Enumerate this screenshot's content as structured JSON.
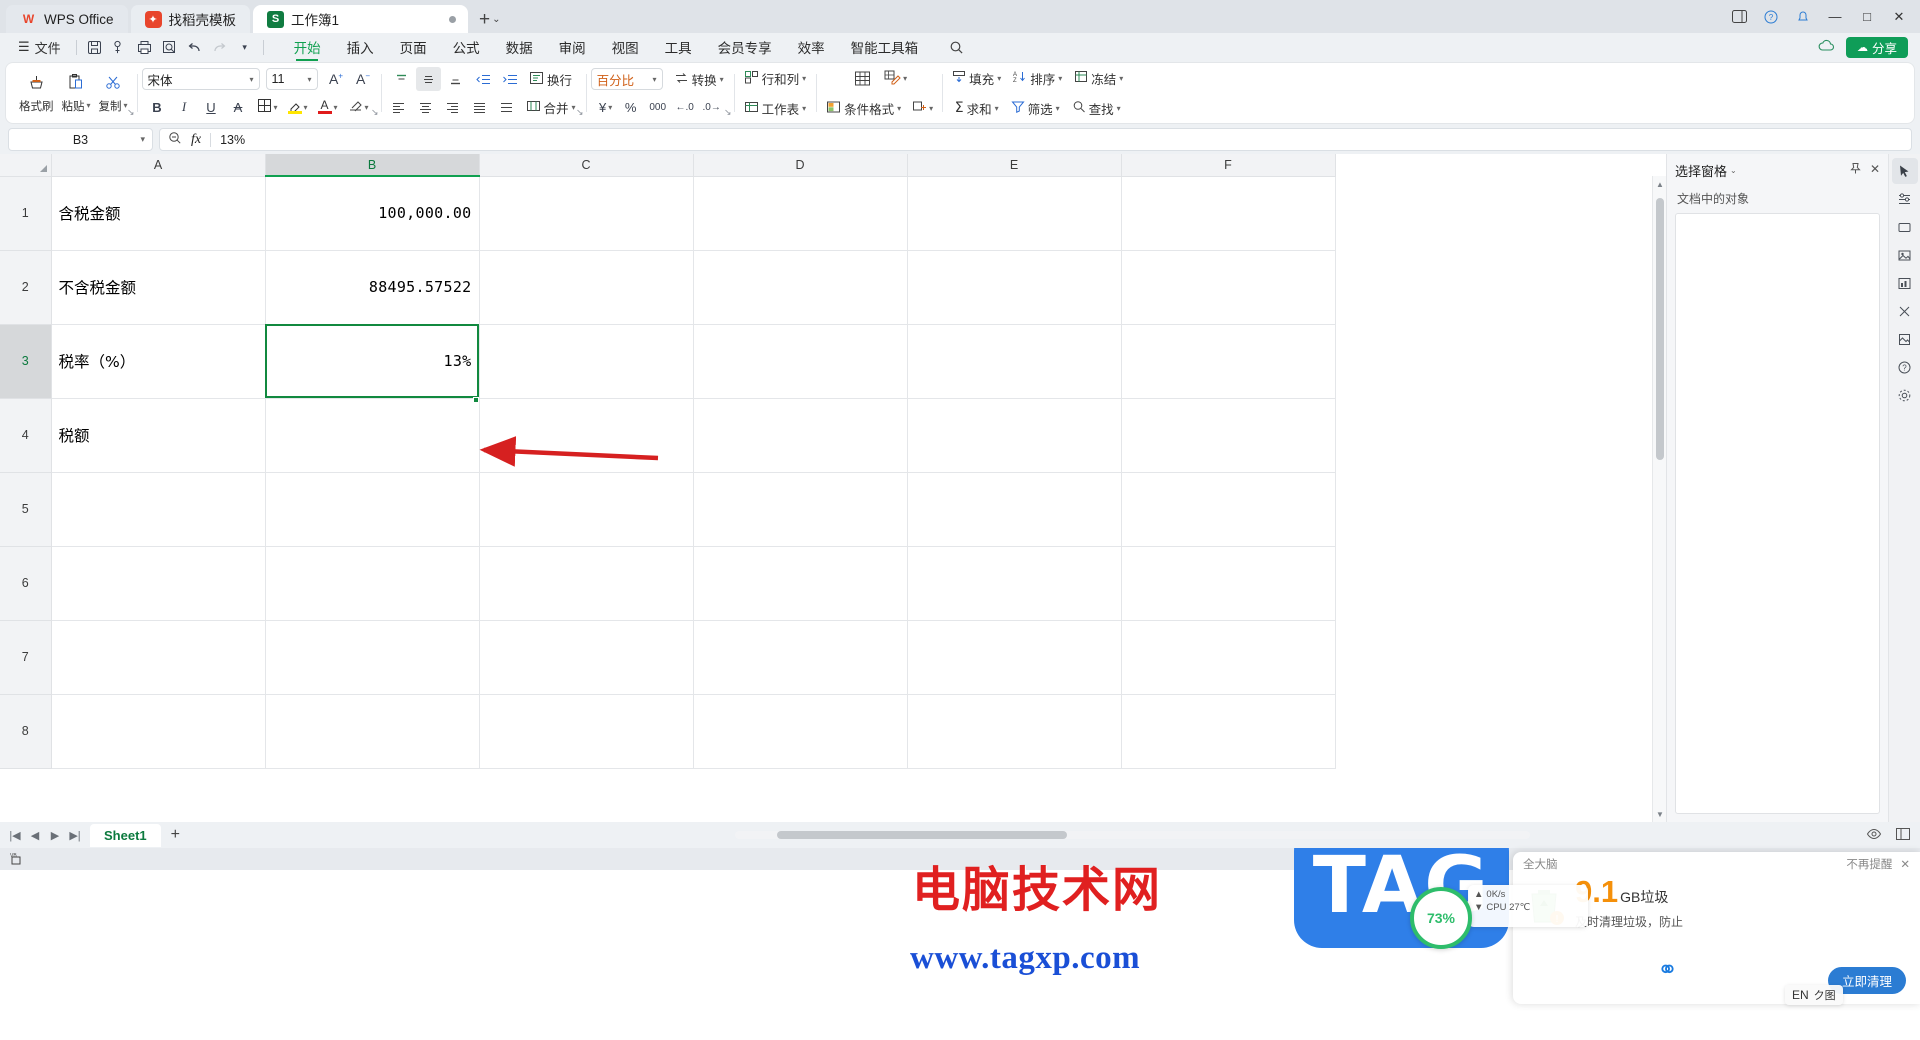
{
  "titlebar": {
    "tabs": [
      {
        "label": "WPS Office",
        "icon": "wps-logo-icon"
      },
      {
        "label": "找稻壳模板",
        "icon": "daoke-logo-icon"
      },
      {
        "label": "工作簿1",
        "icon": "spreadsheet-icon"
      }
    ],
    "new_tab": "+",
    "new_tab_caret": "⌄",
    "window_controls": [
      "▤",
      "◷",
      "◈",
      "—",
      "▫",
      "✕"
    ]
  },
  "menubar": {
    "file": "文件",
    "file_menu_icon": "hamburger-icon",
    "quick_access": [
      "save-icon",
      "print-preview-icon",
      "print-icon",
      "find-icon",
      "undo-icon",
      "redo-icon",
      "more-icon"
    ],
    "tabs": [
      "开始",
      "插入",
      "页面",
      "公式",
      "数据",
      "审阅",
      "视图",
      "工具",
      "会员专享",
      "效率",
      "智能工具箱"
    ],
    "active_tab": "开始",
    "search_icon": "search-icon",
    "cloud_icon": "cloud-sync-icon",
    "share_label": "分享",
    "share_icon": "share-icon"
  },
  "ribbon": {
    "clipboard": {
      "format_painter": "格式刷",
      "paste": "粘贴",
      "copy": "复制",
      "cut_icon": "scissors-icon",
      "paste_icon": "clipboard-icon",
      "brush_icon": "paint-brush-icon"
    },
    "font": {
      "name": "宋体",
      "size": "11",
      "grow_icon": "A+",
      "shrink_icon": "A−",
      "bold": "B",
      "italic": "I",
      "underline": "U",
      "strikethrough": "A",
      "border_icon": "borders-icon",
      "highlight_icon": "highlight-color-icon",
      "fontcolor_icon": "font-color-icon",
      "clearfmt_icon": "clear-format-icon",
      "highlight_color": "#ffe600",
      "fontcolor_color": "#e01b1b"
    },
    "alignment": {
      "align_top": "top-align-icon",
      "align_middle": "middle-align-icon",
      "align_bottom": "bottom-align-icon",
      "indent_dec": "decrease-indent-icon",
      "indent_inc": "increase-indent-icon",
      "wrap_label": "换行",
      "align_left": "align-left-icon",
      "align_center": "align-center-icon",
      "align_right": "align-right-icon",
      "align_justify": "align-justify-icon",
      "align_dist": "align-distributed-icon",
      "merge_label": "合并"
    },
    "number": {
      "format": "百分比",
      "convert_label": "转换",
      "currency_icon": "currency-icon",
      "percent_icon": "%",
      "comma_icon": "000",
      "inc_dec_icon": "increase-decimal-icon",
      "dec_dec_icon": "decrease-decimal-icon"
    },
    "cells": {
      "rows_cols": "行和列",
      "worksheet": "工作表",
      "conditional_format": "条件格式",
      "table_style_icon": "table-style-icon",
      "cell_style_icon": "cell-style-icon",
      "insert_cell_icon": "insert-cell-icon"
    },
    "editing": {
      "fill": "填充",
      "sort": "排序",
      "freeze": "冻结",
      "sum": "求和",
      "filter": "筛选",
      "find": "查找"
    }
  },
  "formulabar": {
    "name_box": "B3",
    "name_box_caret": "⌄",
    "zoom_icon": "zoom-icon",
    "fx_icon": "fx",
    "value": "13%"
  },
  "grid": {
    "columns": [
      "A",
      "B",
      "C",
      "D",
      "E",
      "F"
    ],
    "selected_column": "B",
    "rows": [
      "1",
      "2",
      "3",
      "4",
      "5",
      "6",
      "7",
      "8"
    ],
    "selected_row": "3",
    "active_cell": "B3",
    "cells": [
      {
        "row": "1",
        "a": "含税金额",
        "b": "100,000.00"
      },
      {
        "row": "2",
        "a": "不含税金额",
        "b": "88495.57522"
      },
      {
        "row": "3",
        "a": "税率（%）",
        "b": "13%"
      },
      {
        "row": "4",
        "a": "税额",
        "b": ""
      },
      {
        "row": "5",
        "a": "",
        "b": ""
      },
      {
        "row": "6",
        "a": "",
        "b": ""
      },
      {
        "row": "7",
        "a": "",
        "b": ""
      },
      {
        "row": "8",
        "a": "",
        "b": ""
      }
    ]
  },
  "selection_pane": {
    "title": "选择窗格",
    "title_caret": "⌄",
    "pin_icon": "pin-icon",
    "close_icon": "close-icon",
    "subtitle": "文档中的对象"
  },
  "right_rail": {
    "items": [
      "cursor-select-icon",
      "properties-icon",
      "shape-icon",
      "picture-icon",
      "chart-icon",
      "table-tools-icon",
      "help-icon",
      "settings-icon"
    ]
  },
  "sheetbar": {
    "nav": [
      "|◀",
      "◀",
      "▶",
      "▶|"
    ],
    "sheets": [
      "Sheet1"
    ],
    "active_sheet": "Sheet1",
    "add_sheet": "+",
    "right_icons": [
      "view-icon",
      "layout-icon",
      "zoom-out-icon",
      "zoom-in-icon"
    ]
  },
  "statusbar": {
    "macro_icon": "vba-macro-icon"
  },
  "annotation": {
    "arrow_color": "#d62020",
    "points_at": "B2"
  },
  "watermarks": {
    "title": "电脑技术网",
    "url": "www.tagxp.com",
    "badge": "TAG"
  },
  "cleaner_popup": {
    "brand": "全大脑",
    "dismiss": "不再提醒",
    "close_icon": "close-icon",
    "size": "9.1",
    "unit": "GB垃圾",
    "description": "及时清理垃圾，防止",
    "action": "立即清理",
    "trash_icon": "trash-recycle-icon"
  },
  "sys_monitor": {
    "gauge_value": "73%",
    "net_speed": "0K/s",
    "cpu_temp": "CPU 27℃",
    "up_icon": "▲",
    "down_icon": "▼"
  },
  "ime": {
    "label": "EN",
    "extra": "ク图"
  },
  "colors": {
    "accent_green": "#10a050",
    "selection_green": "#11893f",
    "share_green": "#0f9d58",
    "annotation_red": "#d62020",
    "orange": "#f5900a",
    "blue": "#2f7fe8"
  }
}
